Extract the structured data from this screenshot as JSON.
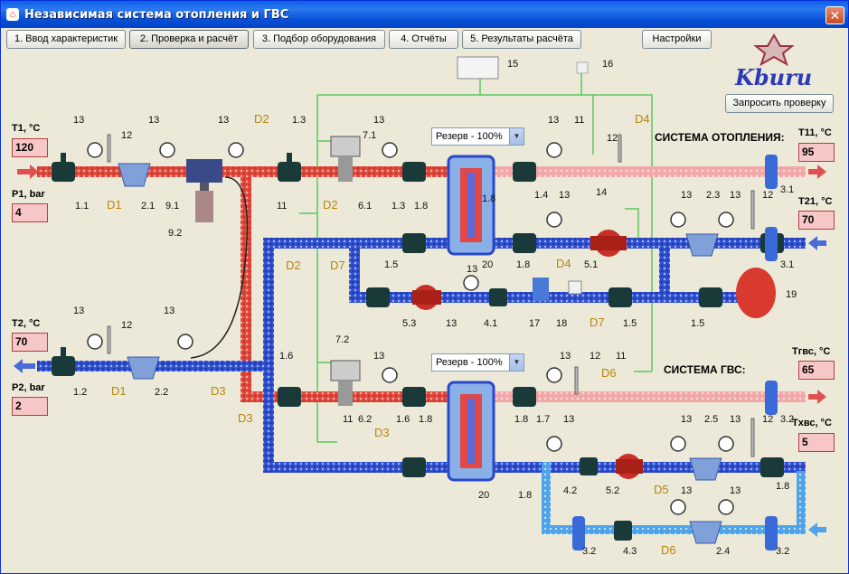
{
  "window": {
    "title": "Независимая система отопления и ГВС",
    "close": "✕"
  },
  "tabs": [
    {
      "label": "1. Ввод характеристик"
    },
    {
      "label": "2. Проверка и расчёт"
    },
    {
      "label": "3. Подбор оборудования"
    },
    {
      "label": "4. Отчёты"
    },
    {
      "label": "5. Результаты расчёта"
    }
  ],
  "settings_label": "Настройки",
  "request_check_label": "Запросить проверку",
  "logo_text": "Kburu",
  "sections": {
    "heating": "СИСТЕМА ОТОПЛЕНИЯ:",
    "hot_water": "СИСТЕМА ГВС:"
  },
  "reserve_select": [
    {
      "value": "Резерв  - 100%"
    },
    {
      "value": "Резерв  - 100%"
    }
  ],
  "params": {
    "t1": {
      "label": "T1, °C",
      "value": "120"
    },
    "p1": {
      "label": "P1, bar",
      "value": "4"
    },
    "t2": {
      "label": "T2, °C",
      "value": "70"
    },
    "p2": {
      "label": "P2, bar",
      "value": "2"
    },
    "t11": {
      "label": "T11, °C",
      "value": "95"
    },
    "t21": {
      "label": "T21, °C",
      "value": "70"
    },
    "tgvs": {
      "label": "Tгвс, °C",
      "value": "65"
    },
    "thvs": {
      "label": "Tхвс, °C",
      "value": "5"
    }
  },
  "colors": {
    "hot": "#e0483c",
    "cold": "#2e4fd0",
    "dhw_cold": "#4fa3e8",
    "hot_light": "#f0a0a0",
    "control_line": "#5ac85a"
  }
}
